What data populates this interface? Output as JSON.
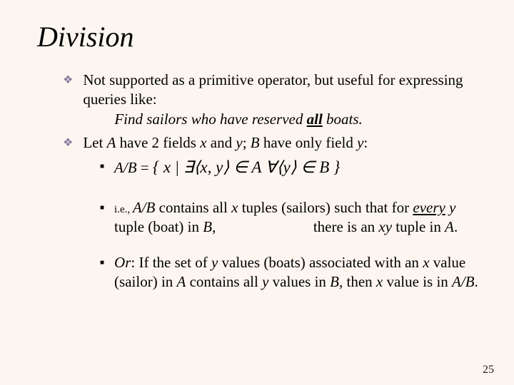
{
  "title": "Division",
  "bullets": {
    "b1_line1": "Not supported as a primitive operator, but useful for expressing queries like:",
    "b1_example_prefix": "Find sailors who have reserved ",
    "b1_example_word": "all",
    "b1_example_suffix": " boats.",
    "b2_prefix": "Let ",
    "b2_A": "A",
    "b2_mid1": " have 2 fields ",
    "b2_x": "x",
    "b2_and": " and ",
    "b2_y": "y",
    "b2_semi": "; ",
    "b2_B": "B",
    "b2_mid2": " have only field ",
    "b2_y2": "y",
    "b2_colon": ":"
  },
  "sub": {
    "s1_ab": "A/B",
    "s1_eq": " = ",
    "s1_formula": "{ x | ∃⟨x, y⟩ ∈ A  ∀⟨y⟩ ∈ B }",
    "s2_ie": "i.e., ",
    "s2_ab": "A/B",
    "s2_p1": " contains all ",
    "s2_x": "x",
    "s2_p2": " tuples (sailors) such that for ",
    "s2_every": "every",
    "s2_sp": " ",
    "s2_y": "y",
    "s2_p3": " tuple (boat) in ",
    "s2_B": "B",
    "s2_comma": ",",
    "s2_gap": "                          ",
    "s2_p4": "there is an ",
    "s2_xy": "xy",
    "s2_p5": " tuple in ",
    "s2_A": "A",
    "s2_dot": ".",
    "s3_or": "Or",
    "s3_p1": ":  If the set of ",
    "s3_y": "y",
    "s3_p2": " values (boats) associated with an ",
    "s3_x": "x",
    "s3_p3": " value (sailor) in ",
    "s3_A": "A",
    "s3_p4": " contains all ",
    "s3_y2": "y",
    "s3_p5": " values in ",
    "s3_B": "B",
    "s3_p6": ", then ",
    "s3_x2": "x",
    "s3_p7": " value is in ",
    "s3_ab": "A/B",
    "s3_dot": "."
  },
  "page": "25"
}
